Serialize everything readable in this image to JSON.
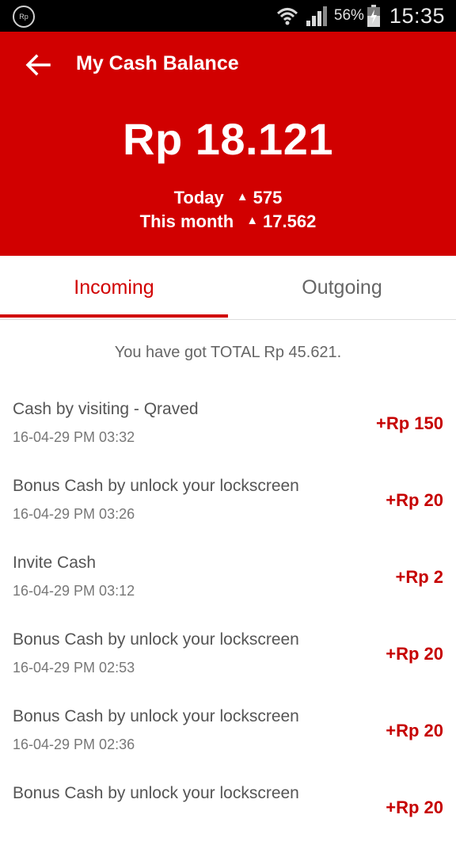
{
  "status_bar": {
    "app_icon": "app-notification-icon",
    "app_icon_text": "Rp",
    "battery_percent": "56%",
    "time": "15:35"
  },
  "header": {
    "title": "My Cash Balance",
    "balance": "Rp 18.121",
    "today_label": "Today",
    "today_value": "575",
    "month_label": "This month",
    "month_value": "17.562",
    "background_color": "#d10000"
  },
  "tabs": [
    {
      "label": "Incoming",
      "selected": true
    },
    {
      "label": "Outgoing",
      "selected": false
    }
  ],
  "total_text": "You have got TOTAL Rp 45.621.",
  "transactions": [
    {
      "title": "Cash by visiting - Qraved",
      "date": "16-04-29  PM 03:32",
      "amount": "+Rp 150"
    },
    {
      "title": "Bonus Cash by unlock your lockscreen",
      "date": "16-04-29  PM 03:26",
      "amount": "+Rp 20"
    },
    {
      "title": "Invite Cash",
      "date": "16-04-29  PM 03:12",
      "amount": "+Rp 2"
    },
    {
      "title": "Bonus Cash by unlock your lockscreen",
      "date": "16-04-29  PM 02:53",
      "amount": "+Rp 20"
    },
    {
      "title": "Bonus Cash by unlock your lockscreen",
      "date": "16-04-29  PM 02:36",
      "amount": "+Rp 20"
    },
    {
      "title": "Bonus Cash by unlock your lockscreen",
      "date": "",
      "amount": "+Rp 20"
    }
  ]
}
